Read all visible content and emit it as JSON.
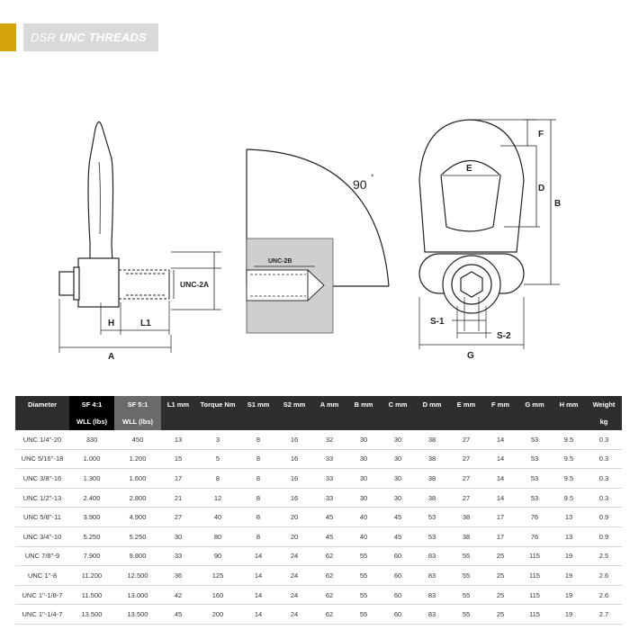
{
  "banner": {
    "prefix": "DSR",
    "title": "UNC THREADS"
  },
  "drawing": {
    "labels": {
      "unc2a": "UNC-2A",
      "h": "H",
      "l1": "L1",
      "a": "A",
      "angle": "90",
      "unc2b": "UNC-2B",
      "f": "F",
      "e": "E",
      "d": "D",
      "b": "B",
      "s1": "S-1",
      "s2": "S-2",
      "g": "G"
    }
  },
  "table": {
    "headers": [
      {
        "line1": "Diameter",
        "line2": ""
      },
      {
        "line1": "SF 4:1",
        "line2": "WLL (lbs)"
      },
      {
        "line1": "SF 5:1",
        "line2": "WLL (lbs)"
      },
      {
        "line1": "L1 mm",
        "line2": ""
      },
      {
        "line1": "Torque Nm",
        "line2": ""
      },
      {
        "line1": "S1 mm",
        "line2": ""
      },
      {
        "line1": "S2 mm",
        "line2": ""
      },
      {
        "line1": "A mm",
        "line2": ""
      },
      {
        "line1": "B mm",
        "line2": ""
      },
      {
        "line1": "C mm",
        "line2": ""
      },
      {
        "line1": "D mm",
        "line2": ""
      },
      {
        "line1": "E mm",
        "line2": ""
      },
      {
        "line1": "F mm",
        "line2": ""
      },
      {
        "line1": "G mm",
        "line2": ""
      },
      {
        "line1": "H mm",
        "line2": ""
      },
      {
        "line1": "Weight",
        "line2": "kg"
      }
    ],
    "rows": [
      [
        "UNC 1/4''-20",
        "330",
        "450",
        "13",
        "3",
        "8",
        "16",
        "32",
        "30",
        "30",
        "38",
        "27",
        "14",
        "53",
        "9.5",
        "0.3"
      ],
      [
        "UNC 5/16''-18",
        "1.000",
        "1.200",
        "15",
        "5",
        "8",
        "16",
        "33",
        "30",
        "30",
        "38",
        "27",
        "14",
        "53",
        "9.5",
        "0.3"
      ],
      [
        "UNC 3/8''-16",
        "1.300",
        "1.600",
        "17",
        "8",
        "8",
        "16",
        "33",
        "30",
        "30",
        "38",
        "27",
        "14",
        "53",
        "9.5",
        "0.3"
      ],
      [
        "UNC 1/2''-13",
        "2.400",
        "2.800",
        "21",
        "12",
        "8",
        "16",
        "33",
        "30",
        "30",
        "38",
        "27",
        "14",
        "53",
        "9.5",
        "0.3"
      ],
      [
        "UNC 5/8''-11",
        "3.900",
        "4.900",
        "27",
        "40",
        "8",
        "20",
        "45",
        "40",
        "45",
        "53",
        "38",
        "17",
        "76",
        "13",
        "0.9"
      ],
      [
        "UNC 3/4''-10",
        "5.250",
        "5.250",
        "30",
        "80",
        "8",
        "20",
        "45",
        "40",
        "45",
        "53",
        "38",
        "17",
        "76",
        "13",
        "0.9"
      ],
      [
        "UNC 7/8''-9",
        "7.900",
        "9.800",
        "33",
        "90",
        "14",
        "24",
        "62",
        "55",
        "60",
        "83",
        "55",
        "25",
        "115",
        "19",
        "2.5"
      ],
      [
        "UNC 1''-8",
        "11.200",
        "12.500",
        "36",
        "125",
        "14",
        "24",
        "62",
        "55",
        "60",
        "83",
        "55",
        "25",
        "115",
        "19",
        "2.6"
      ],
      [
        "UNC 1''-1/8-7",
        "11.500",
        "13.000",
        "42",
        "160",
        "14",
        "24",
        "62",
        "55",
        "60",
        "83",
        "55",
        "25",
        "115",
        "19",
        "2.6"
      ],
      [
        "UNC 1''-1/4-7",
        "13.500",
        "13.500",
        "45",
        "200",
        "14",
        "24",
        "62",
        "55",
        "60",
        "83",
        "55",
        "25",
        "115",
        "19",
        "2.7"
      ]
    ]
  }
}
